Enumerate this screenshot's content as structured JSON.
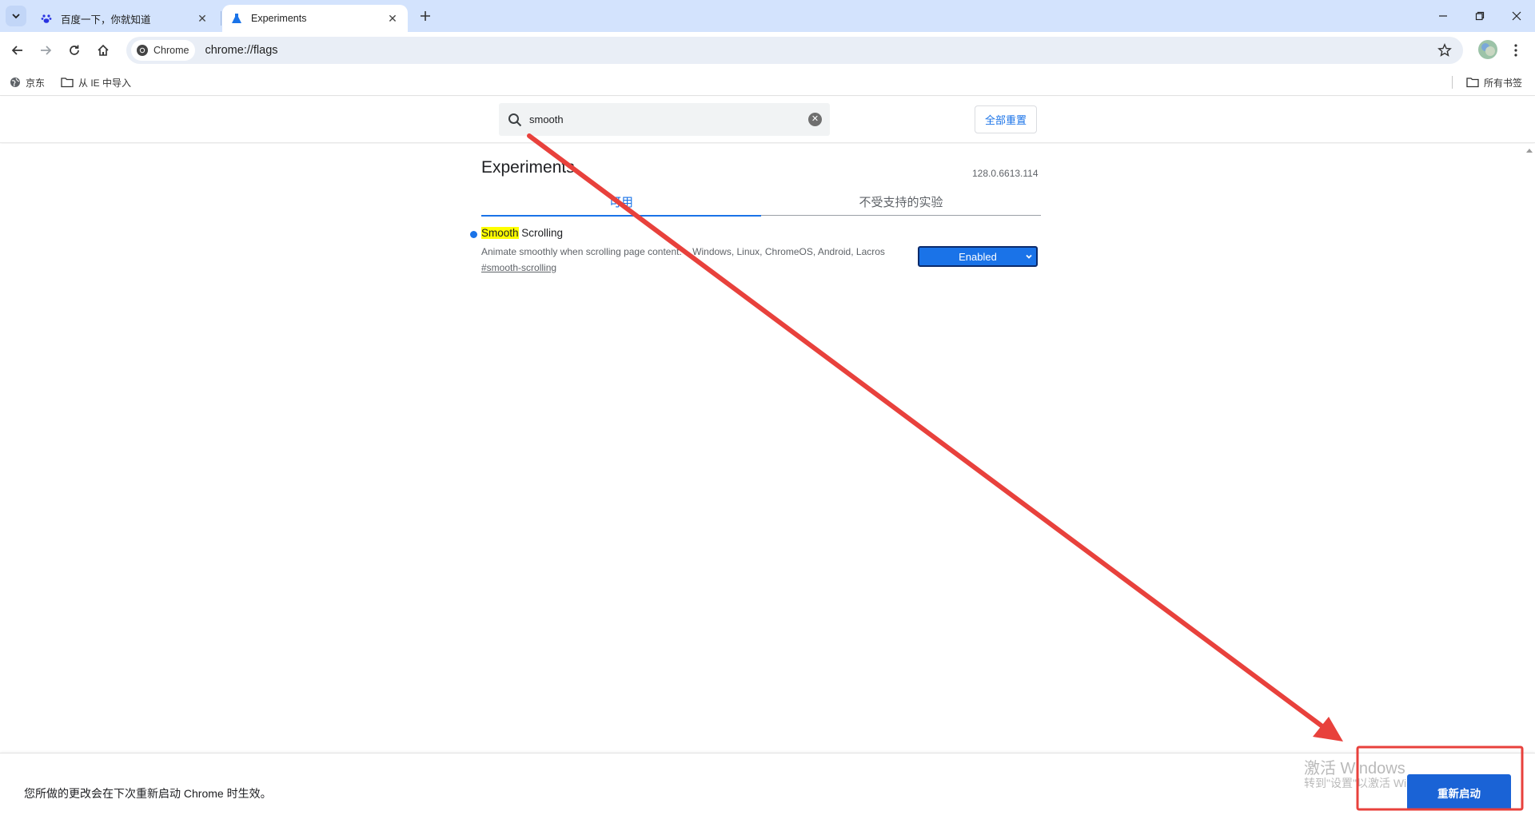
{
  "browser": {
    "tabs": [
      {
        "title": "百度一下，你就知道",
        "favicon": "baidu-paw-icon",
        "active": false
      },
      {
        "title": "Experiments",
        "favicon": "flask-icon",
        "active": true
      }
    ],
    "address_bar": {
      "chip_label": "Chrome",
      "url": "chrome://flags"
    },
    "bookmarks": [
      {
        "label": "京东",
        "icon": "globe-icon"
      },
      {
        "label": "从 IE 中导入",
        "icon": "folder-icon"
      }
    ],
    "all_bookmarks_label": "所有书签"
  },
  "flags": {
    "search_value": "smooth",
    "reset_all_label": "全部重置",
    "title": "Experiments",
    "version": "128.0.6613.114",
    "tabs": [
      {
        "label": "可用",
        "active": true
      },
      {
        "label": "不受支持的实验",
        "active": false
      }
    ],
    "experiment": {
      "name_highlight": "Smooth",
      "name_rest": " Scrolling",
      "description": "Animate smoothly when scrolling page content. – Windows, Linux, ChromeOS, Android, Lacros",
      "link": "#smooth-scrolling",
      "selected_option": "Enabled"
    }
  },
  "footer": {
    "message": "您所做的更改会在下次重新启动 Chrome 时生效。",
    "relaunch_label": "重新启动"
  },
  "watermark": {
    "line1": "激活 Windows",
    "line2": "转到\"设置\"以激活 Windows。"
  },
  "colors": {
    "accent": "#1a73e8",
    "tabstrip": "#d3e3fd",
    "annotation_red": "#e8413c",
    "highlight": "#ffff00"
  }
}
